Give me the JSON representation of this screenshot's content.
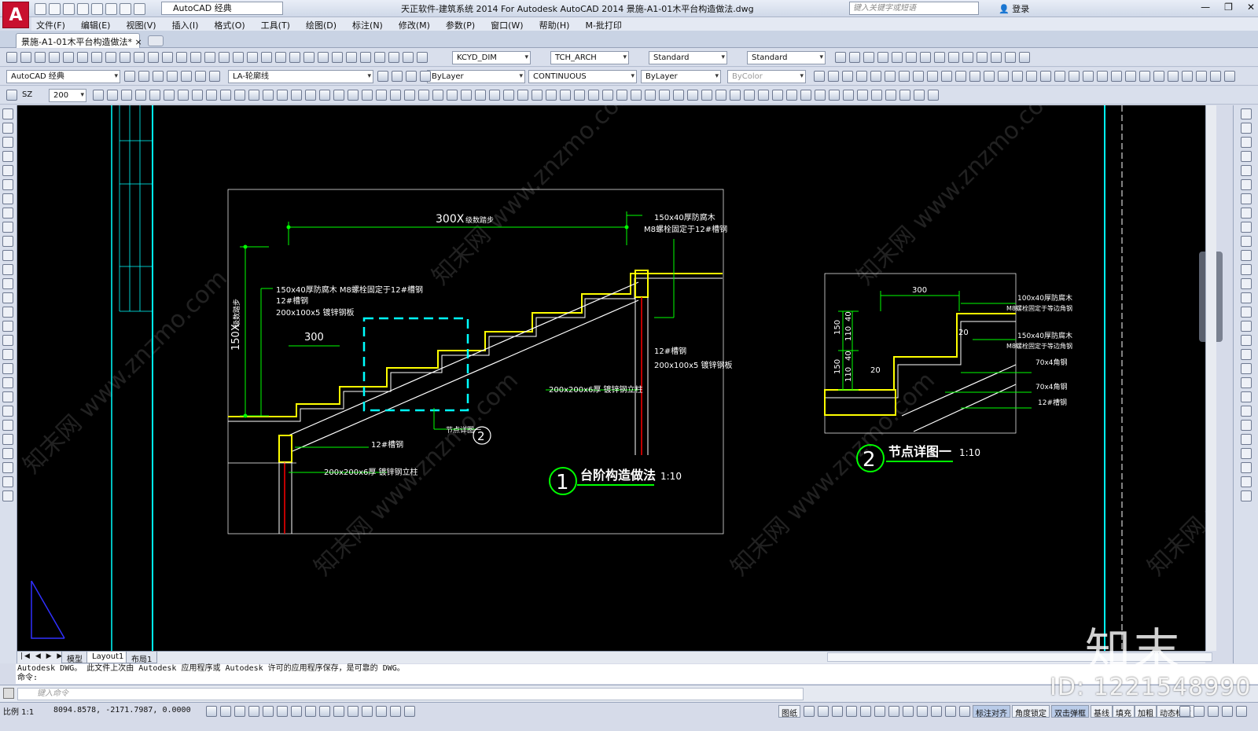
{
  "app": {
    "logo_letter": "A",
    "workspace": "AutoCAD 经典",
    "window_title": "天正软件-建筑系统 2014  For Autodesk AutoCAD 2014    景施-A1-01木平台构造做法.dwg",
    "search_placeholder": "键入关键字或短语",
    "login_label": "登录",
    "window_buttons": [
      "—",
      "❐",
      "✕"
    ]
  },
  "menu": [
    "文件(F)",
    "编辑(E)",
    "视图(V)",
    "插入(I)",
    "格式(O)",
    "工具(T)",
    "绘图(D)",
    "标注(N)",
    "修改(M)",
    "参数(P)",
    "窗口(W)",
    "帮助(H)",
    "M-批打印"
  ],
  "document_tab": {
    "label": "景施-A1-01木平台构造做法*",
    "close": "×"
  },
  "toolbar_row1": {
    "text_style": "KCYD_DIM",
    "dim_style": "TCH_ARCH",
    "table_style": "Standard",
    "mleader_style": "Standard"
  },
  "toolbar_row2": {
    "workspace": "AutoCAD 经典",
    "layer": "LA-轮廓线",
    "color": "ByLayer",
    "linetype": "CONTINUOUS",
    "lineweight": "ByLayer",
    "plotstyle": "ByColor"
  },
  "toolbar_row3": {
    "label": "SZ",
    "value": "200"
  },
  "drawing": {
    "detail1": {
      "width_dim": "300X",
      "width_note": "级数踏步",
      "height_dim": "150X",
      "height_note": "级数踏步",
      "top_note_1": "150x40厚防腐木",
      "top_note_2": "M8螺栓固定于12#槽钢",
      "left_note_1": "150x40厚防腐木 M8螺栓固定于12#槽钢",
      "left_note_2": "12#槽钢",
      "left_note_3": "200x100x5   镀锌钢板",
      "tread_dim": "300",
      "right_note_1": "12#槽钢",
      "right_note_2": "200x100x5   镀锌钢板",
      "mid_note": "200x200x6厚   镀锌钢立柱",
      "bottom_note_1": "12#槽钢",
      "bottom_note_2": "200x200x6厚   镀锌钢立柱",
      "callout_label": "节点详图一",
      "callout_num": "2",
      "title_num": "1",
      "title": "台阶构造做法",
      "scale": "1:10"
    },
    "detail2": {
      "dim_300": "300",
      "dim_150a": "150",
      "dim_150b": "150",
      "dim_40a": "40",
      "dim_110a": "110",
      "dim_40b": "40",
      "dim_110b": "110",
      "dim_20a": "20",
      "dim_20b": "20",
      "note_1": "100x40厚防腐木",
      "note_2": "M8螺栓固定于等边角钢",
      "note_3": "150x40厚防腐木",
      "note_4": "M8螺栓固定于等边角钢",
      "note_5": "70x4角钢",
      "note_6": "70x4角钢",
      "note_7": "12#槽钢",
      "title_num": "2",
      "title": "节点详图一",
      "scale": "1:10"
    },
    "watermark_text": "知末网 www.znzmo.com"
  },
  "layout_tabs": {
    "nav": "|◀ ◀ ▶ ▶|",
    "tabs": [
      "模型",
      "Layout1",
      "布局1"
    ],
    "active": 1
  },
  "command": {
    "history_1": "Autodesk DWG。  此文件上次由 Autodesk 应用程序或 Autodesk 许可的应用程序保存，是可靠的 DWG。",
    "history_2": "命令:",
    "placeholder": "键入命令"
  },
  "status": {
    "scale": "比例 1:1",
    "coords": "8094.8578, -2171.7987, 0.0000",
    "buttons": [
      "图纸",
      "标注对齐",
      "角度锁定",
      "双击弹框",
      "基线",
      "填充",
      "加粗",
      "动态标注"
    ]
  },
  "overlay": {
    "brand": "知末",
    "id": "ID: 1221548990"
  },
  "colors": {
    "green": "#00ff00",
    "yellow": "#ffff00",
    "cyan": "#00ffff",
    "red": "#ff0000",
    "white": "#ffffff"
  }
}
